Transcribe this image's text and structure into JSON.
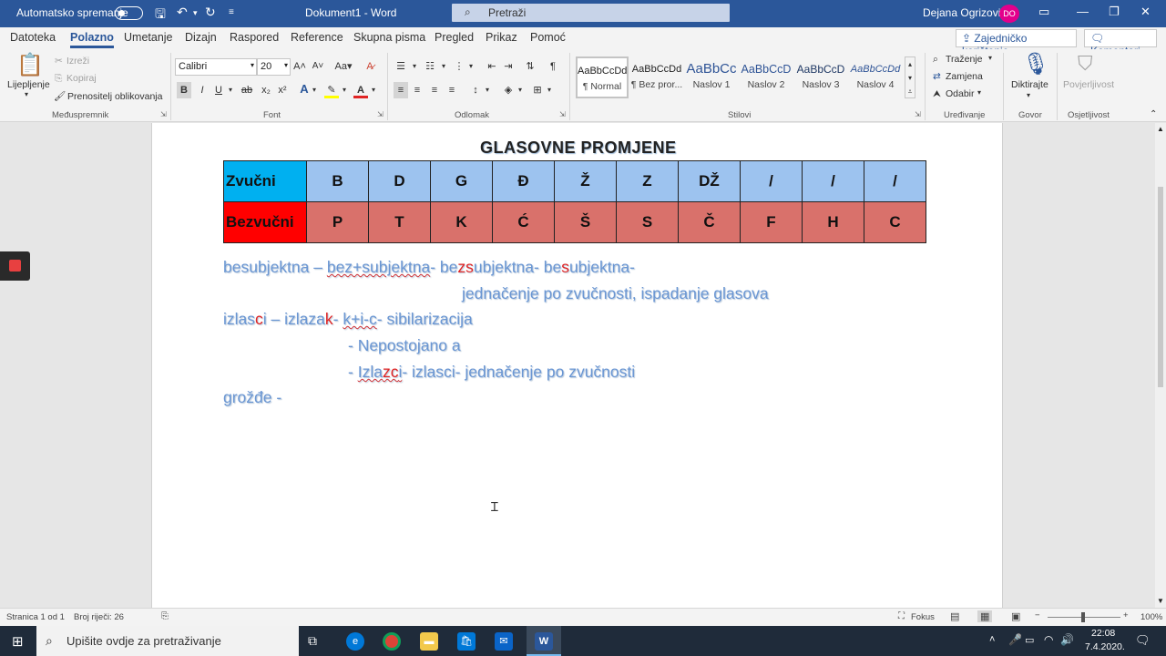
{
  "titlebar": {
    "autosave_label": "Automatsko spremanje",
    "doc_title": "Dokument1  -  Word",
    "search_placeholder": "Pretraži",
    "user_name": "Dejana Ogrizović",
    "user_initials": "DO"
  },
  "tabs": [
    "Datoteka",
    "Polazno",
    "Umetanje",
    "Dizajn",
    "Raspored",
    "Reference",
    "Skupna pisma",
    "Pregled",
    "Prikaz",
    "Pomoć"
  ],
  "share": {
    "share_label": "Zajedničko korištenje",
    "comments_label": "Komentari"
  },
  "ribbon": {
    "clipboard": {
      "paste": "Lijepljenje",
      "cut": "Izreži",
      "copy": "Kopiraj",
      "painter": "Prenositelj oblikovanja",
      "label": "Međuspremnik"
    },
    "font": {
      "name": "Calibri",
      "size": "20",
      "label": "Font"
    },
    "paragraph": {
      "label": "Odlomak"
    },
    "styles": {
      "label": "Stilovi",
      "items": [
        {
          "preview": "AaBbCcDd",
          "name": "¶ Normal"
        },
        {
          "preview": "AaBbCcDd",
          "name": "¶ Bez pror..."
        },
        {
          "preview": "AaBbCc",
          "name": "Naslov 1"
        },
        {
          "preview": "AaBbCcD",
          "name": "Naslov 2"
        },
        {
          "preview": "AaBbCcD",
          "name": "Naslov 3"
        },
        {
          "preview": "AaBbCcDd",
          "name": "Naslov 4"
        }
      ]
    },
    "editing": {
      "find": "Traženje",
      "replace": "Zamjena",
      "select": "Odabir",
      "label": "Uređivanje"
    },
    "voice": {
      "dictate": "Diktirajte",
      "label": "Govor"
    },
    "sensitivity": {
      "btn": "Povjerljivost",
      "label": "Osjetljivost"
    }
  },
  "document": {
    "title": "GLASOVNE  PROMJENE",
    "table": {
      "row1_head": "Zvučni",
      "row1": [
        "B",
        "D",
        "G",
        "Đ",
        "Ž",
        "Z",
        "DŽ",
        "/",
        "/",
        "/"
      ],
      "row2_head": "Bezvučni",
      "row2": [
        "P",
        "T",
        "K",
        "Ć",
        "Š",
        "S",
        "Č",
        "F",
        "H",
        "C"
      ]
    },
    "lines": {
      "l1a": "besubjektna –  ",
      "l1b": "bez+subjektna",
      "l1c": "- be",
      "l1d": "z",
      "l1e": "s",
      "l1f": "ubjektna- be",
      "l1g": "s",
      "l1h": "ubjektna-",
      "l2": "jednačenje po zvučnosti, ispadanje glasova",
      "l3a": "izlas",
      "l3b": "c",
      "l3c": "i –   izlaza",
      "l3d": "k",
      "l3e": "-  ",
      "l3f": "k+i-c",
      "l3g": "- sibilarizacija",
      "l4": "-   Nepostojano a",
      "l5a": "-   ",
      "l5b": "Izla",
      "l5c": "zc",
      "l5d": "i",
      "l5e": "- izlasci- jednačenje po zvučnosti",
      "l6": "grožđe  -"
    }
  },
  "statusbar": {
    "page": "Stranica 1 od 1",
    "words": "Broj riječi: 26",
    "focus": "Fokus",
    "zoom": "100%"
  },
  "taskbar": {
    "search_placeholder": "Upišite ovdje za pretraživanje",
    "time": "22:08",
    "date": "7.4.2020."
  }
}
